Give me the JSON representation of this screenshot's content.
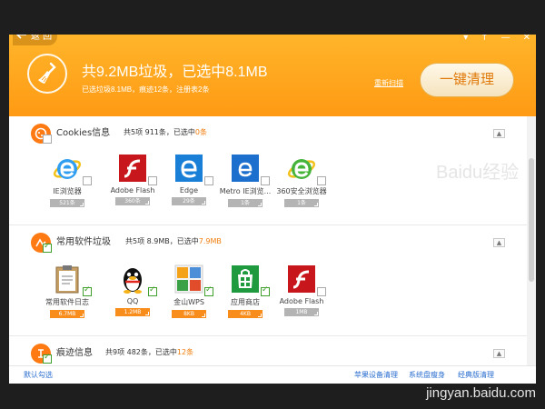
{
  "header": {
    "back_label": "返 回",
    "window_controls": [
      "▾",
      "↑",
      "—",
      "✕"
    ],
    "headline": "共9.2MB垃圾，已选中8.1MB",
    "subline": "已选垃圾8.1MB，痕迹12条，注册表2条",
    "rescan": "重新扫描",
    "clean_button": "一键清理",
    "colors": {
      "orange_top": "#ffb52a",
      "orange_bottom": "#ff9a14",
      "accent": "#f07e0e"
    }
  },
  "sections": [
    {
      "title": "Cookies信息",
      "summary_prefix": "共5项 911条，已选中",
      "summary_value": "0条",
      "icon": "cookie-icon",
      "items": [
        {
          "label": "IE浏览器",
          "size": "521条",
          "icon": "ie-icon",
          "checked": false
        },
        {
          "label": "Adobe Flash",
          "size": "360条",
          "icon": "flash-icon",
          "checked": false
        },
        {
          "label": "Edge",
          "size": "29条",
          "icon": "edge-icon",
          "checked": false
        },
        {
          "label": "Metro IE浏览...",
          "size": "1条",
          "icon": "metro-ie-icon",
          "checked": false
        },
        {
          "label": "360安全浏览器",
          "size": "1条",
          "icon": "360-browser-icon",
          "checked": false
        }
      ]
    },
    {
      "title": "常用软件垃圾",
      "summary_prefix": "共5项 8.9MB，已选中",
      "summary_value": "7.9MB",
      "icon": "software-icon",
      "items": [
        {
          "label": "常用软件日志",
          "size": "6.7MB",
          "icon": "clipboard-icon",
          "checked": true
        },
        {
          "label": "QQ",
          "size": "1.2MB",
          "icon": "qq-penguin-icon",
          "checked": true
        },
        {
          "label": "金山WPS",
          "size": "8KB",
          "icon": "wps-icon",
          "checked": true
        },
        {
          "label": "应用商店",
          "size": "4KB",
          "icon": "store-icon",
          "checked": true
        },
        {
          "label": "Adobe Flash",
          "size": "1MB",
          "icon": "flash-icon",
          "checked": false
        }
      ]
    },
    {
      "title": "痕迹信息",
      "summary_prefix": "共9项 482条，已选中",
      "summary_value": "12条",
      "icon": "trace-icon",
      "items": []
    }
  ],
  "collapse_glyph": "▲",
  "footer": {
    "left_link": "默认勾选",
    "links": [
      "苹果设备清理",
      "系统盘瘦身",
      "经典版清理"
    ]
  },
  "watermark": {
    "mid": "Baidu经验",
    "bottom": "jingyan.baidu.com"
  }
}
